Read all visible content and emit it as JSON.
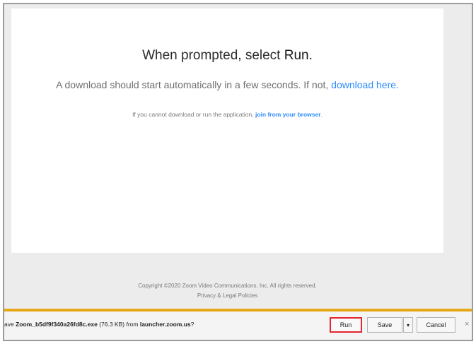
{
  "page": {
    "headline_prefix": "When prompted, select ",
    "headline_strong": "Run.",
    "subline_text": "A download should start automatically in a few seconds. If not, ",
    "subline_link": "download here.",
    "small_text": "If you cannot download or run the application, ",
    "small_link": "join from your browser",
    "small_suffix": "."
  },
  "footer": {
    "copyright": "Copyright ©2020 Zoom Video Communications, Inc. All rights reserved.",
    "policy_link": "Privacy & Legal Policies"
  },
  "download_bar": {
    "prefix": "ave ",
    "filename": "Zoom_b5df9f340a26fd8c.exe",
    "size": " (76.3 KB) from ",
    "source": "launcher.zoom.us",
    "suffix": "?",
    "run_label": "Run",
    "save_label": "Save",
    "save_arrow": "▾",
    "cancel_label": "Cancel",
    "close_label": "×"
  },
  "colors": {
    "link": "#2d8cff",
    "download_bar_accent": "#e6a817",
    "run_highlight": "#e3262f"
  }
}
